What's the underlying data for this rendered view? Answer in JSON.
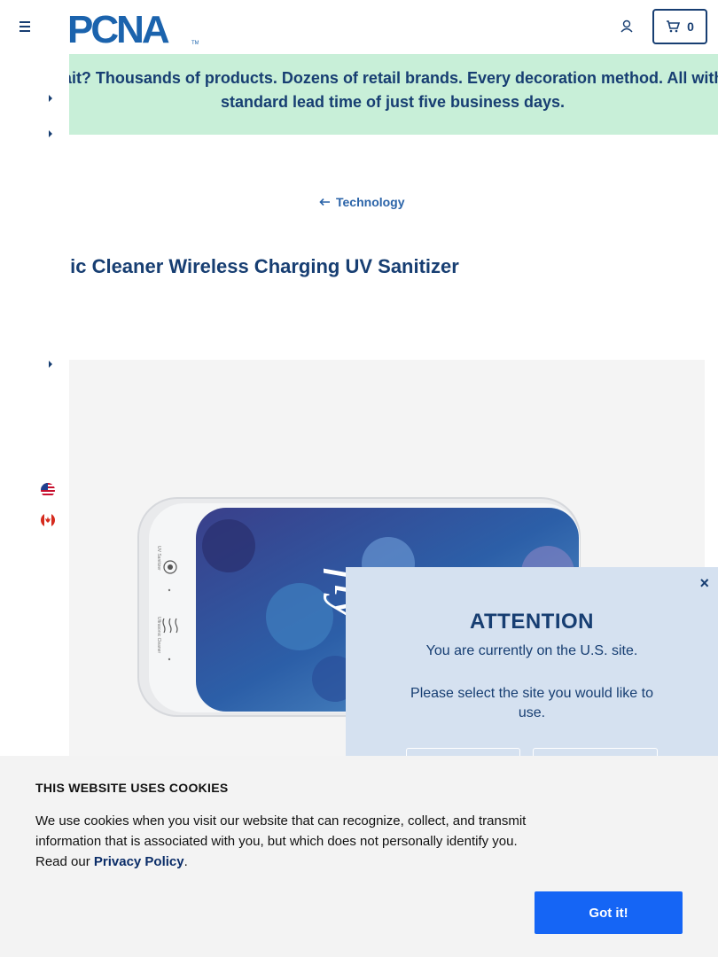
{
  "header": {
    "logo_text": "PCNA",
    "cart_count": "0"
  },
  "banner": {
    "text": "Wait? Thousands of products. Dozens of retail brands. Every decoration method. All with a standard lead time of just five business days."
  },
  "breadcrumb": {
    "arrow": "←",
    "label": "Technology"
  },
  "product": {
    "title": "sonic Cleaner Wireless Charging UV Sanitizer",
    "device_label_uv": "UV Sanitizer",
    "device_label_ultra": "Ultrasonic Cleaner",
    "screen_text": "fly"
  },
  "site_modal": {
    "close": "×",
    "title": "ATTENTION",
    "line1": "You are currently on the U.S. site.",
    "line2": "Please select the site you would like to use."
  },
  "cookie": {
    "title": "THIS WEBSITE USES COOKIES",
    "body_before": "We use cookies when you visit our website that can recognize, collect, and transmit information that is associated with you, but which does not personally identify you. Read our ",
    "link": "Privacy Policy",
    "body_after": ".",
    "button": "Got it!"
  },
  "colors": {
    "brand_navy": "#173e72",
    "banner_green": "#c8efd8",
    "modal_blue": "#d5e1f0",
    "cookie_button": "#1565f5"
  }
}
